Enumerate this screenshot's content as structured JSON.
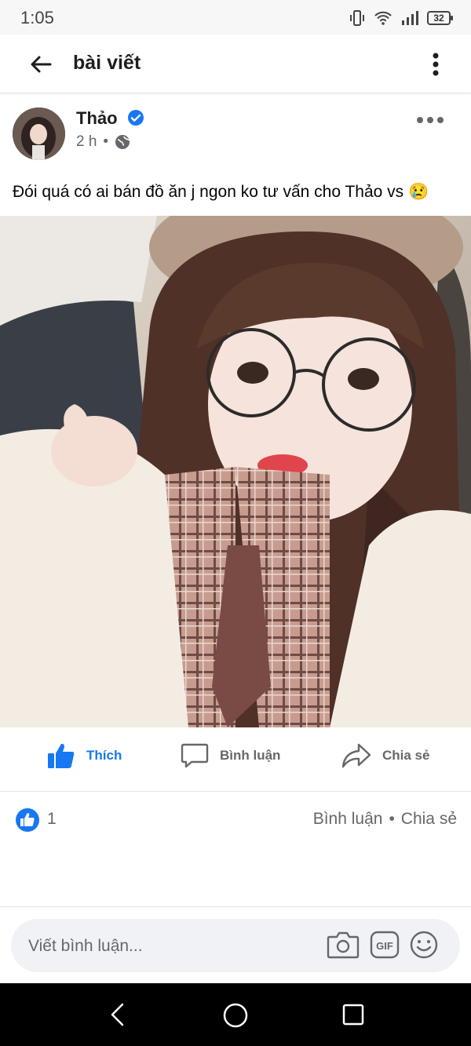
{
  "status": {
    "time": "1:05",
    "battery": "32"
  },
  "app_bar": {
    "title": "bài viết"
  },
  "post": {
    "author": "Thảo",
    "time": "2 h",
    "separator": "•",
    "text": "Đói quá có ai bán đồ ăn j ngon ko tư vấn cho Thảo vs 😢"
  },
  "actions": {
    "like": "Thích",
    "comment": "Bình luận",
    "share": "Chia sẻ"
  },
  "reactions": {
    "like_count": "1",
    "comments": "Bình luận",
    "dot": "•",
    "shares": "Chia sẻ"
  },
  "comment": {
    "placeholder": "Viết bình luận..."
  },
  "colors": {
    "accent": "#1877f2",
    "muted": "#65676b"
  }
}
